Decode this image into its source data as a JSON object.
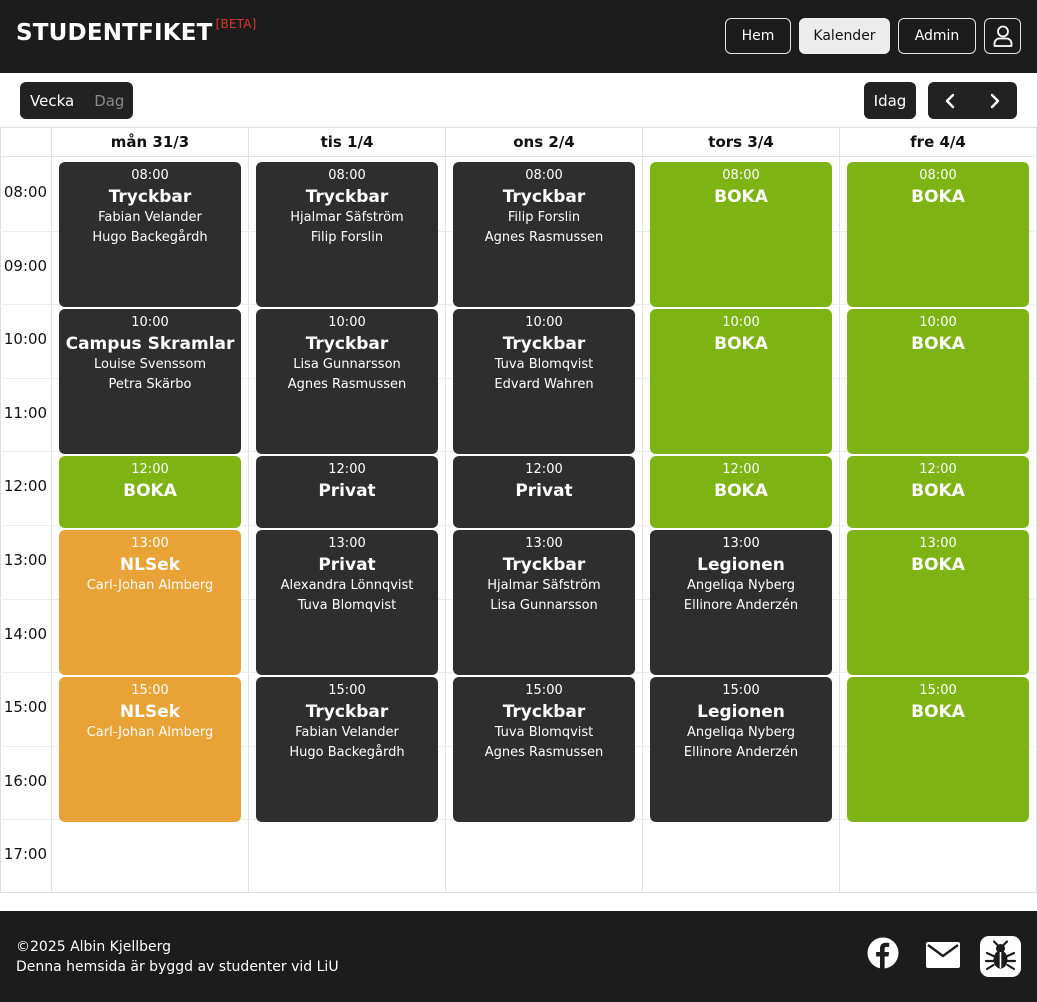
{
  "brand": {
    "name": "STUDENTFIKET",
    "badge": "[BETA]"
  },
  "nav": {
    "hem": "Hem",
    "kalender": "Kalender",
    "admin": "Admin"
  },
  "toolbar": {
    "week": "Vecka",
    "day": "Dag",
    "today": "Idag"
  },
  "days": [
    "mån 31/3",
    "tis 1/4",
    "ons 2/4",
    "tors 3/4",
    "fre 4/4"
  ],
  "hours": [
    "08:00",
    "09:00",
    "10:00",
    "11:00",
    "12:00",
    "13:00",
    "14:00",
    "15:00",
    "16:00",
    "17:00"
  ],
  "events": [
    {
      "day": 0,
      "start": "08:00",
      "hours": 2,
      "color": "dark",
      "title": "Tryckbar",
      "people": [
        "Fabian Velander",
        "Hugo Backegårdh"
      ]
    },
    {
      "day": 0,
      "start": "10:00",
      "hours": 2,
      "color": "dark",
      "title": "Campus Skramlar",
      "people": [
        "Louise Svenssom",
        "Petra Skärbo"
      ]
    },
    {
      "day": 0,
      "start": "12:00",
      "hours": 1,
      "color": "green",
      "title": "BOKA",
      "people": []
    },
    {
      "day": 0,
      "start": "13:00",
      "hours": 2,
      "color": "orange",
      "title": "NLSek",
      "people": [
        "Carl-Johan Almberg"
      ]
    },
    {
      "day": 0,
      "start": "15:00",
      "hours": 2,
      "color": "orange",
      "title": "NLSek",
      "people": [
        "Carl-Johan Almberg"
      ]
    },
    {
      "day": 1,
      "start": "08:00",
      "hours": 2,
      "color": "dark",
      "title": "Tryckbar",
      "people": [
        "Hjalmar Säfström",
        "Filip Forslin"
      ]
    },
    {
      "day": 1,
      "start": "10:00",
      "hours": 2,
      "color": "dark",
      "title": "Tryckbar",
      "people": [
        "Lisa Gunnarsson",
        "Agnes Rasmussen"
      ]
    },
    {
      "day": 1,
      "start": "12:00",
      "hours": 1,
      "color": "dark",
      "title": "Privat",
      "people": []
    },
    {
      "day": 1,
      "start": "13:00",
      "hours": 2,
      "color": "dark",
      "title": "Privat",
      "people": [
        "Alexandra Lönnqvist",
        "Tuva Blomqvist"
      ]
    },
    {
      "day": 1,
      "start": "15:00",
      "hours": 2,
      "color": "dark",
      "title": "Tryckbar",
      "people": [
        "Fabian Velander",
        "Hugo Backegårdh"
      ]
    },
    {
      "day": 2,
      "start": "08:00",
      "hours": 2,
      "color": "dark",
      "title": "Tryckbar",
      "people": [
        "Filip Forslin",
        "Agnes Rasmussen"
      ]
    },
    {
      "day": 2,
      "start": "10:00",
      "hours": 2,
      "color": "dark",
      "title": "Tryckbar",
      "people": [
        "Tuva Blomqvist",
        "Edvard Wahren"
      ]
    },
    {
      "day": 2,
      "start": "12:00",
      "hours": 1,
      "color": "dark",
      "title": "Privat",
      "people": []
    },
    {
      "day": 2,
      "start": "13:00",
      "hours": 2,
      "color": "dark",
      "title": "Tryckbar",
      "people": [
        "Hjalmar Säfström",
        "Lisa Gunnarsson"
      ]
    },
    {
      "day": 2,
      "start": "15:00",
      "hours": 2,
      "color": "dark",
      "title": "Tryckbar",
      "people": [
        "Tuva Blomqvist",
        "Agnes Rasmussen"
      ]
    },
    {
      "day": 3,
      "start": "08:00",
      "hours": 2,
      "color": "green",
      "title": "BOKA",
      "people": []
    },
    {
      "day": 3,
      "start": "10:00",
      "hours": 2,
      "color": "green",
      "title": "BOKA",
      "people": []
    },
    {
      "day": 3,
      "start": "12:00",
      "hours": 1,
      "color": "green",
      "title": "BOKA",
      "people": []
    },
    {
      "day": 3,
      "start": "13:00",
      "hours": 2,
      "color": "dark",
      "title": "Legionen",
      "people": [
        "Angeliqa Nyberg",
        "Ellinore Anderzén"
      ]
    },
    {
      "day": 3,
      "start": "15:00",
      "hours": 2,
      "color": "dark",
      "title": "Legionen",
      "people": [
        "Angeliqa Nyberg",
        "Ellinore Anderzén"
      ]
    },
    {
      "day": 4,
      "start": "08:00",
      "hours": 2,
      "color": "green",
      "title": "BOKA",
      "people": []
    },
    {
      "day": 4,
      "start": "10:00",
      "hours": 2,
      "color": "green",
      "title": "BOKA",
      "people": []
    },
    {
      "day": 4,
      "start": "12:00",
      "hours": 1,
      "color": "green",
      "title": "BOKA",
      "people": []
    },
    {
      "day": 4,
      "start": "13:00",
      "hours": 2,
      "color": "green",
      "title": "BOKA",
      "people": []
    },
    {
      "day": 4,
      "start": "15:00",
      "hours": 2,
      "color": "green",
      "title": "BOKA",
      "people": []
    }
  ],
  "footer": {
    "copyright": "©2025 Albin Kjellberg",
    "tagline": "Denna hemsida är byggd av studenter vid LiU",
    "icons": [
      "facebook-icon",
      "mail-icon",
      "bug-icon"
    ]
  }
}
